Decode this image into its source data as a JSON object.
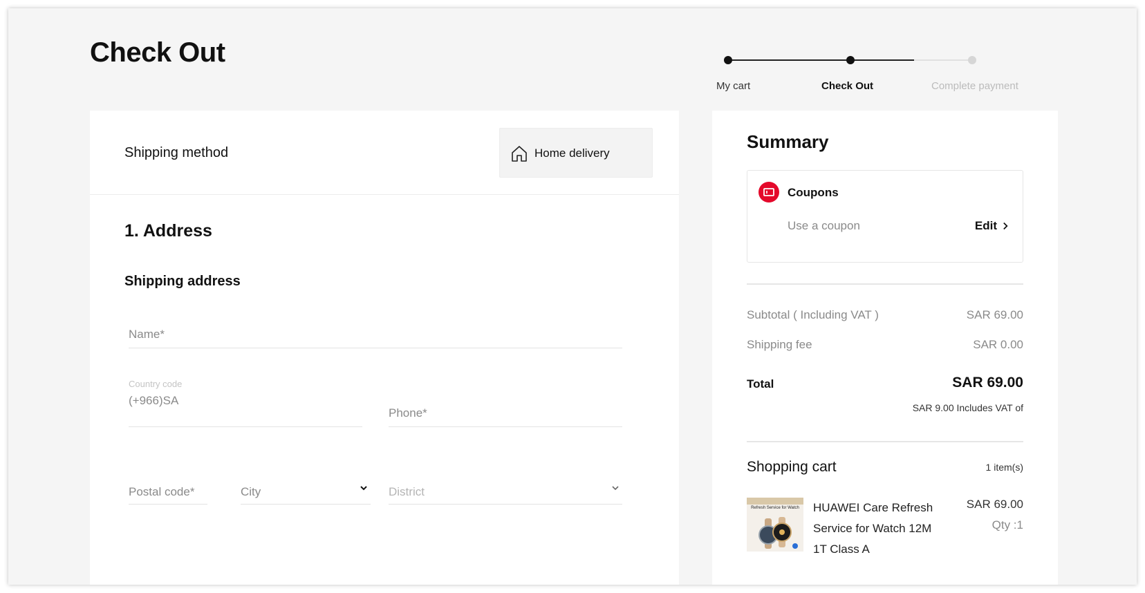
{
  "page": {
    "title": "Check Out"
  },
  "stepper": {
    "steps": [
      {
        "label": "My cart",
        "state": "done"
      },
      {
        "label": "Check Out",
        "state": "current"
      },
      {
        "label": "Complete payment",
        "state": "todo"
      }
    ]
  },
  "shipping": {
    "label": "Shipping method",
    "option": {
      "label": "Home delivery",
      "icon": "home-icon"
    }
  },
  "address": {
    "section_title": "1. Address",
    "subtitle": "Shipping address",
    "name_placeholder": "Name*",
    "country_code_caption": "Country code",
    "country_code_value": "(+966)SA",
    "phone_placeholder": "Phone*",
    "postal_placeholder": "Postal code*",
    "city_placeholder": "City",
    "district_placeholder": "District"
  },
  "summary": {
    "title": "Summary",
    "coupon": {
      "title": "Coupons",
      "placeholder": "Use a coupon",
      "edit_label": "Edit",
      "icon_color": "#e4092b"
    },
    "subtotal_label": "Subtotal ( Including VAT )",
    "subtotal_value": "SAR 69.00",
    "shipping_label": "Shipping fee",
    "shipping_value": "SAR 0.00",
    "total_label": "Total",
    "total_value": "SAR 69.00",
    "vat_note": "SAR 9.00 Includes VAT of"
  },
  "cart": {
    "title": "Shopping cart",
    "count": "1 item(s)",
    "items": [
      {
        "name": "HUAWEI Care Refresh Service for Watch 12M1T Class A",
        "price": "SAR 69.00",
        "qty": "Qty :1",
        "thumb_caption": "Refresh Service for Watch"
      }
    ]
  }
}
